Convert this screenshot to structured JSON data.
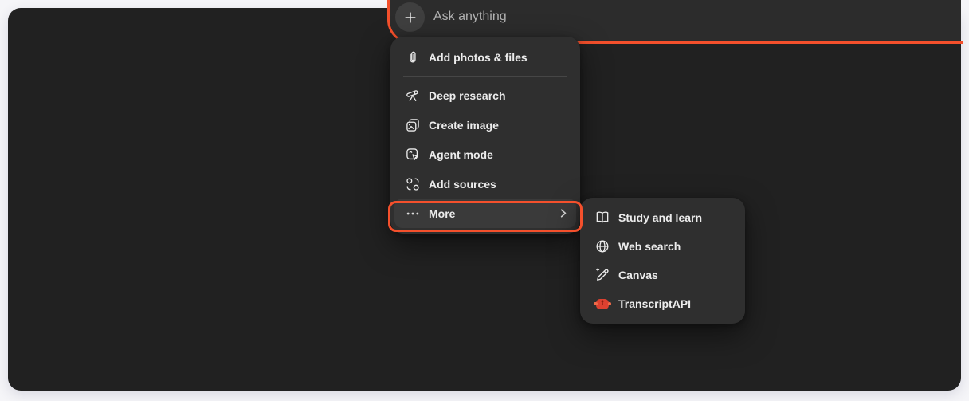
{
  "colors": {
    "page_bg": "#f5f5f8",
    "window_bg": "#212121",
    "panel_bg": "#2f2f2f",
    "composer_bg": "#2c2c2c",
    "annotation_orange": "#f4502c",
    "text": "#ececec",
    "muted_text": "#b3b3b3",
    "divider": "#464646",
    "transcript_badge_red": "#dc4130"
  },
  "composer": {
    "placeholder": "Ask anything",
    "add_button_icon": "plus-icon"
  },
  "menu": {
    "items": [
      {
        "label": "Add photos & files",
        "icon": "paperclip-icon"
      },
      {
        "label": "Deep research",
        "icon": "telescope-icon"
      },
      {
        "label": "Create image",
        "icon": "images-icon"
      },
      {
        "label": "Agent mode",
        "icon": "agent-cursor-icon"
      },
      {
        "label": "Add sources",
        "icon": "sources-icon"
      },
      {
        "label": "More",
        "icon": "ellipsis-icon",
        "has_submenu": true,
        "chevron_icon": "chevron-right-icon",
        "highlighted": true
      }
    ]
  },
  "submenu": {
    "items": [
      {
        "label": "Study and learn",
        "icon": "open-book-icon"
      },
      {
        "label": "Web search",
        "icon": "globe-icon"
      },
      {
        "label": "Canvas",
        "icon": "pencil-sparkle-icon"
      },
      {
        "label": "TranscriptAPI",
        "icon": "transcript-api-badge-icon",
        "badge_letter": "t"
      }
    ]
  }
}
